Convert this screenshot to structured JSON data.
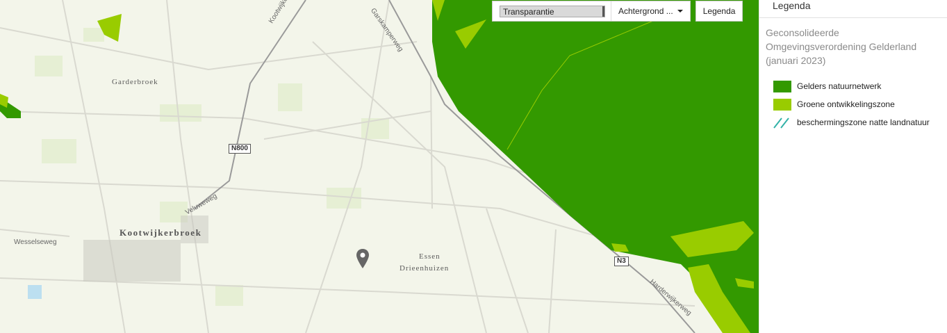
{
  "toolbar": {
    "transparency_label": "Transparantie",
    "background_label": "Achtergrond ...",
    "legend_button": "Legenda"
  },
  "map": {
    "places": [
      "Garderbroek",
      "Kootwijkerbroek",
      "Essen",
      "Drieenhuizen"
    ],
    "roads": [
      "Kootwijkerbroekerweg",
      "Garskamperweg",
      "Veluweweg",
      "Wesselseweg",
      "Harderwijkerweg"
    ],
    "route_shields": [
      "N800",
      "N3"
    ],
    "pin_icon": "map-pin-icon"
  },
  "legend": {
    "title": "Legenda",
    "layer_title": "Geconsolideerde Omgevingsverordening Gelderland (januari 2023)",
    "items": [
      {
        "label": "Gelders natuurnetwerk",
        "color": "#339900",
        "style": "fill"
      },
      {
        "label": "Groene ontwikkelingszone",
        "color": "#99cc00",
        "style": "fill"
      },
      {
        "label": "beschermingszone natte landnatuur",
        "color": "#33b2a8",
        "style": "hatch"
      }
    ]
  }
}
